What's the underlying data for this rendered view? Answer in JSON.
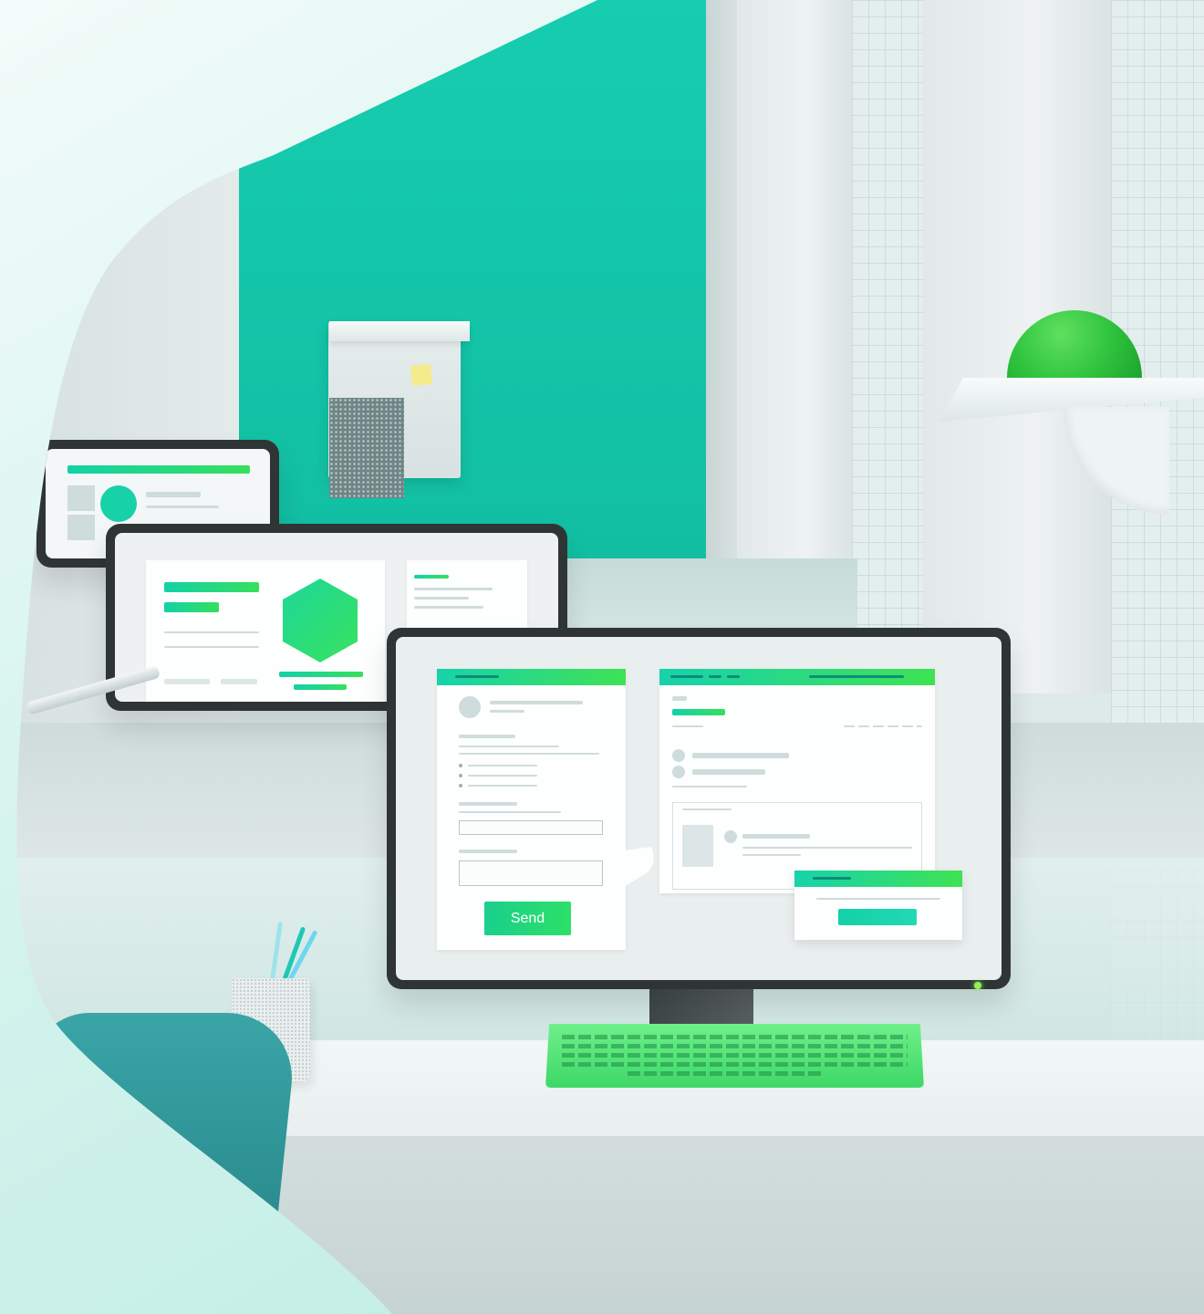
{
  "scene": {
    "accent_teal": "#16cdb0",
    "accent_green": "#2fc33d",
    "chair_color": "#2f9497",
    "background": "#d9f4ee"
  },
  "main_monitor": {
    "form_window": {
      "send_label": "Send"
    }
  },
  "icons": [
    "hexagon-icon",
    "avatar-placeholder"
  ]
}
